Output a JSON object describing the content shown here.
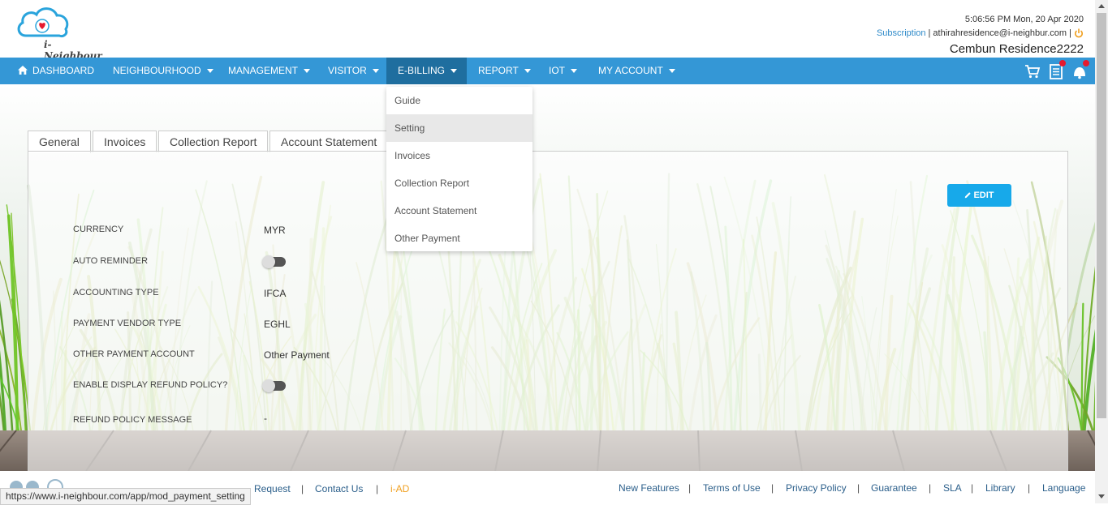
{
  "header": {
    "logo_text": "i-Neighbour",
    "time": "5:06:56 PM  Mon, 20 Apr 2020",
    "subscription": "Subscription",
    "email": "| athirahresidence@i-neighbur.com |",
    "residence": "Cembun Residence2222"
  },
  "nav": {
    "items": [
      {
        "label": "DASHBOARD"
      },
      {
        "label": "NEIGHBOURHOOD"
      },
      {
        "label": "MANAGEMENT"
      },
      {
        "label": "VISITOR"
      },
      {
        "label": "E-BILLING"
      },
      {
        "label": "REPORT"
      },
      {
        "label": "IOT"
      },
      {
        "label": "MY ACCOUNT"
      }
    ],
    "icons": [
      "cart-icon",
      "document-icon",
      "notification-icon"
    ]
  },
  "dropdown": {
    "items": [
      {
        "label": "Guide"
      },
      {
        "label": "Setting"
      },
      {
        "label": "Invoices"
      },
      {
        "label": "Collection Report"
      },
      {
        "label": "Account Statement"
      },
      {
        "label": "Other Payment"
      }
    ]
  },
  "tabs": [
    {
      "label": "General"
    },
    {
      "label": "Invoices"
    },
    {
      "label": "Collection Report"
    },
    {
      "label": "Account Statement"
    }
  ],
  "edit_label": "EDIT",
  "settings": [
    {
      "label": "CURRENCY",
      "value": "MYR"
    },
    {
      "label": "AUTO REMINDER",
      "toggle": "off"
    },
    {
      "label": "ACCOUNTING TYPE",
      "value": "IFCA"
    },
    {
      "label": "PAYMENT VENDOR TYPE",
      "value": "EGHL"
    },
    {
      "label": "OTHER PAYMENT ACCOUNT",
      "value": "Other Payment"
    },
    {
      "label": "ENABLE DISPLAY REFUND POLICY?",
      "toggle": "off"
    },
    {
      "label": "REFUND POLICY MESSAGE",
      "value": "-"
    }
  ],
  "footer": {
    "left": [
      "Request",
      "Contact Us",
      "i-AD"
    ],
    "right": [
      "New Features",
      "Terms of Use",
      "Privacy Policy",
      "Guarantee",
      "SLA",
      "Library",
      "Language"
    ],
    "status_url": "https://www.i-neighbour.com/app/mod_payment_setting"
  },
  "colors": {
    "nav_bg": "#3497d6",
    "nav_active": "#1f6e9f",
    "edit_button": "#17a9ea",
    "notification_dot": "#e6192e",
    "power_icon": "#f0a020"
  }
}
